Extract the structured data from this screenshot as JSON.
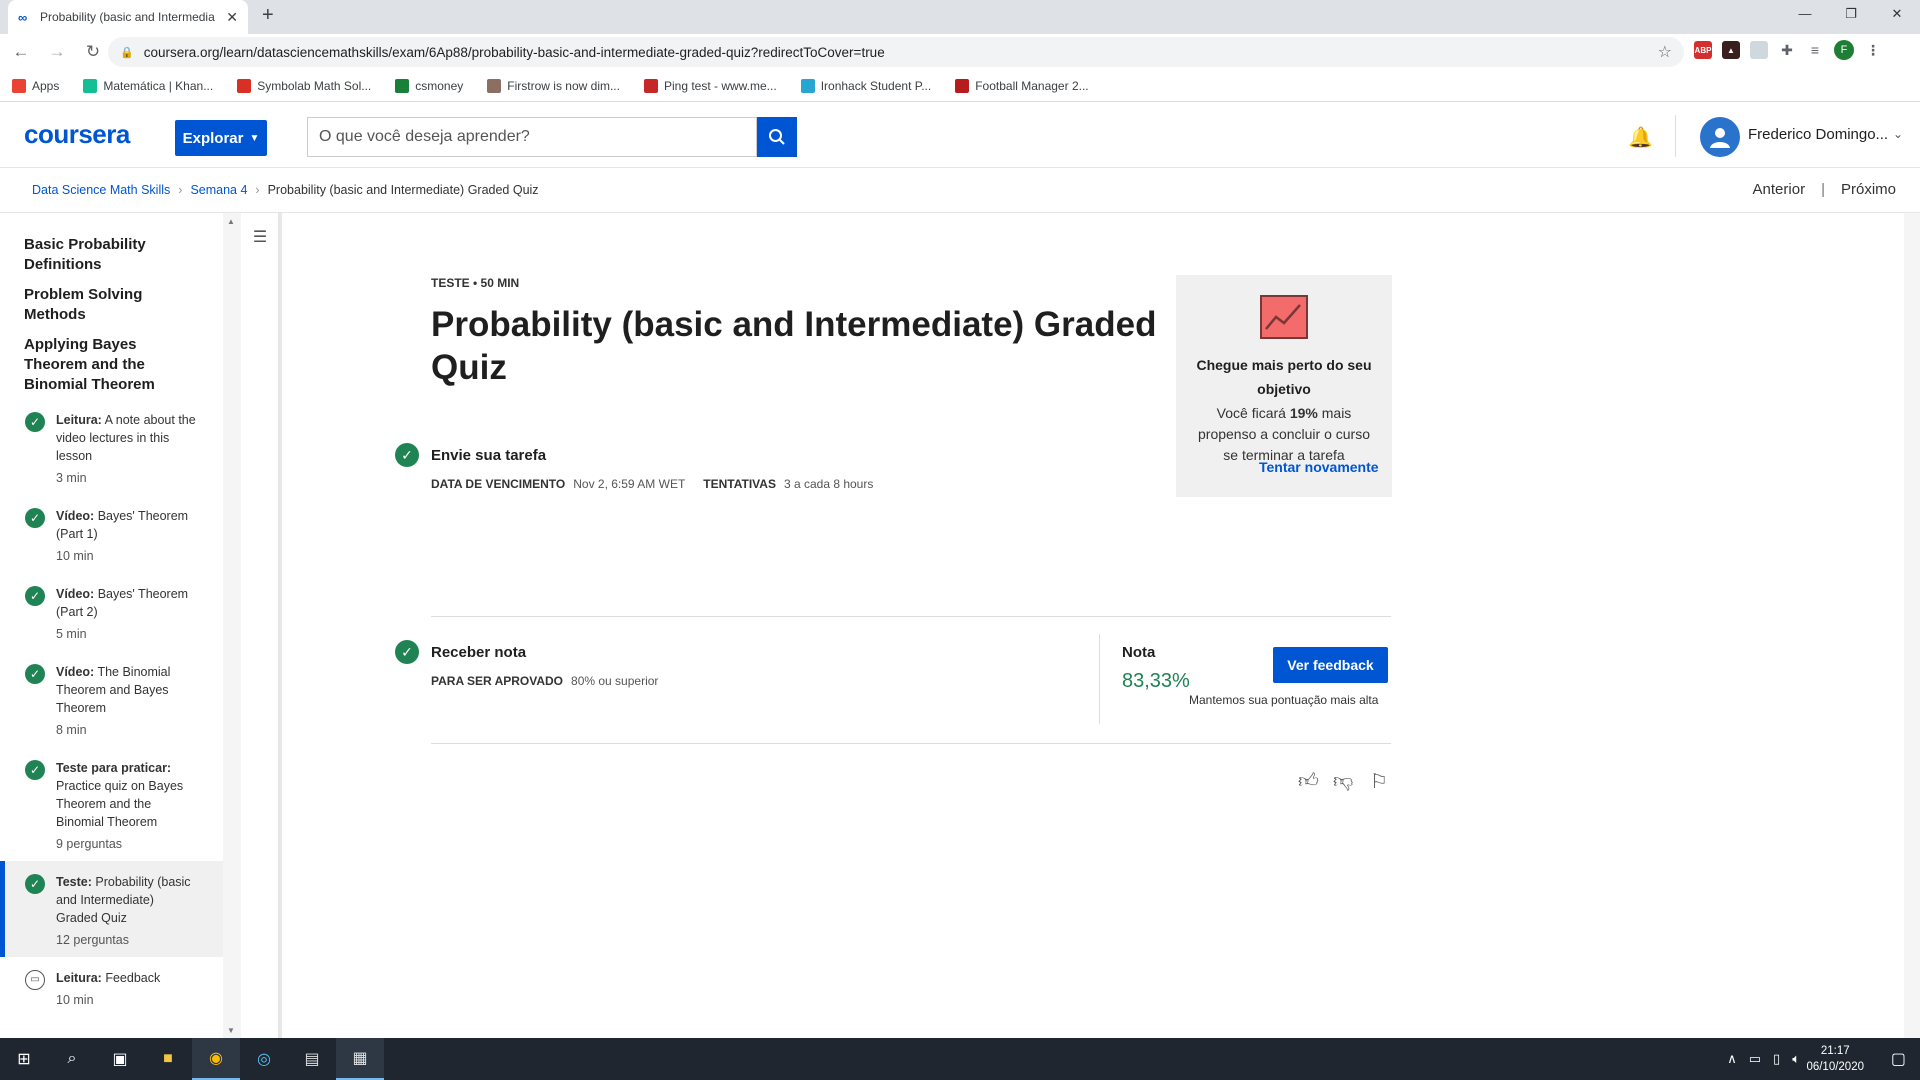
{
  "browser": {
    "tab_title": "Probability (basic and Intermedia",
    "url": "coursera.org/learn/datasciencemathskills/exam/6Ap88/probability-basic-and-intermediate-graded-quiz?redirectToCover=true",
    "bookmarks": [
      {
        "label": "Apps",
        "color": "#ea4335"
      },
      {
        "label": "Matemática | Khan...",
        "color": "#14bf96"
      },
      {
        "label": "Symbolab Math Sol...",
        "color": "#d93025"
      },
      {
        "label": "csmoney",
        "color": "#188038"
      },
      {
        "label": "Firstrow is now dim...",
        "color": "#8d6e63"
      },
      {
        "label": "Ping test - www.me...",
        "color": "#c62828"
      },
      {
        "label": "Ironhack Student P...",
        "color": "#26a6d1"
      },
      {
        "label": "Football Manager 2...",
        "color": "#b71c1c"
      }
    ],
    "profile_initial": "F"
  },
  "header": {
    "logo": "coursera",
    "explore_label": "Explorar",
    "search_placeholder": "O que você deseja aprender?",
    "user_name": "Frederico Domingo..."
  },
  "breadcrumb": {
    "items": [
      "Data Science Math Skills",
      "Semana 4"
    ],
    "current": "Probability (basic and Intermediate) Graded Quiz",
    "prev_label": "Anterior",
    "next_label": "Próximo"
  },
  "sidebar": {
    "sections": [
      "Basic Probability Definitions",
      "Problem Solving Methods",
      "Applying Bayes Theorem and the Binomial Theorem"
    ],
    "items": [
      {
        "type": "Leitura:",
        "title": "A note about the video lectures in this lesson",
        "meta": "3 min"
      },
      {
        "type": "Vídeo:",
        "title": "Bayes' Theorem (Part 1)",
        "meta": "10 min"
      },
      {
        "type": "Vídeo:",
        "title": "Bayes' Theorem (Part 2)",
        "meta": "5 min"
      },
      {
        "type": "Vídeo:",
        "title": "The Binomial Theorem and Bayes Theorem",
        "meta": "8 min"
      },
      {
        "type": "Teste para praticar:",
        "title": "Practice quiz on Bayes Theorem and the Binomial Theorem",
        "meta": "9 perguntas"
      },
      {
        "type": "Teste:",
        "title": "Probability (basic and Intermediate) Graded Quiz",
        "meta": "12 perguntas"
      },
      {
        "type": "Leitura:",
        "title": "Feedback",
        "meta": "10 min"
      }
    ]
  },
  "quiz": {
    "eyebrow": "TESTE • 50 MIN",
    "title": "Probability (basic and Intermediate) Graded Quiz",
    "goal": {
      "title": "Chegue mais perto do seu objetivo",
      "text_before": "Você ficará ",
      "percent": "19%",
      "text_after": " mais propenso a concluir o curso se terminar a tarefa"
    },
    "submit": {
      "title": "Envie sua tarefa",
      "due_label": "DATA DE VENCIMENTO",
      "due_value": "Nov 2, 6:59 AM WET",
      "attempts_label": "TENTATIVAS",
      "attempts_value": "3 a cada 8 hours",
      "retry_label": "Tentar novamente"
    },
    "grade": {
      "title": "Receber nota",
      "pass_label": "PARA SER APROVADO",
      "pass_value": "80% ou superior",
      "grade_label": "Nota",
      "grade_value": "83,33%",
      "feedback_button": "Ver feedback",
      "note": "Mantemos sua pontuação mais alta"
    }
  },
  "taskbar": {
    "time": "21:17",
    "date": "06/10/2020"
  }
}
